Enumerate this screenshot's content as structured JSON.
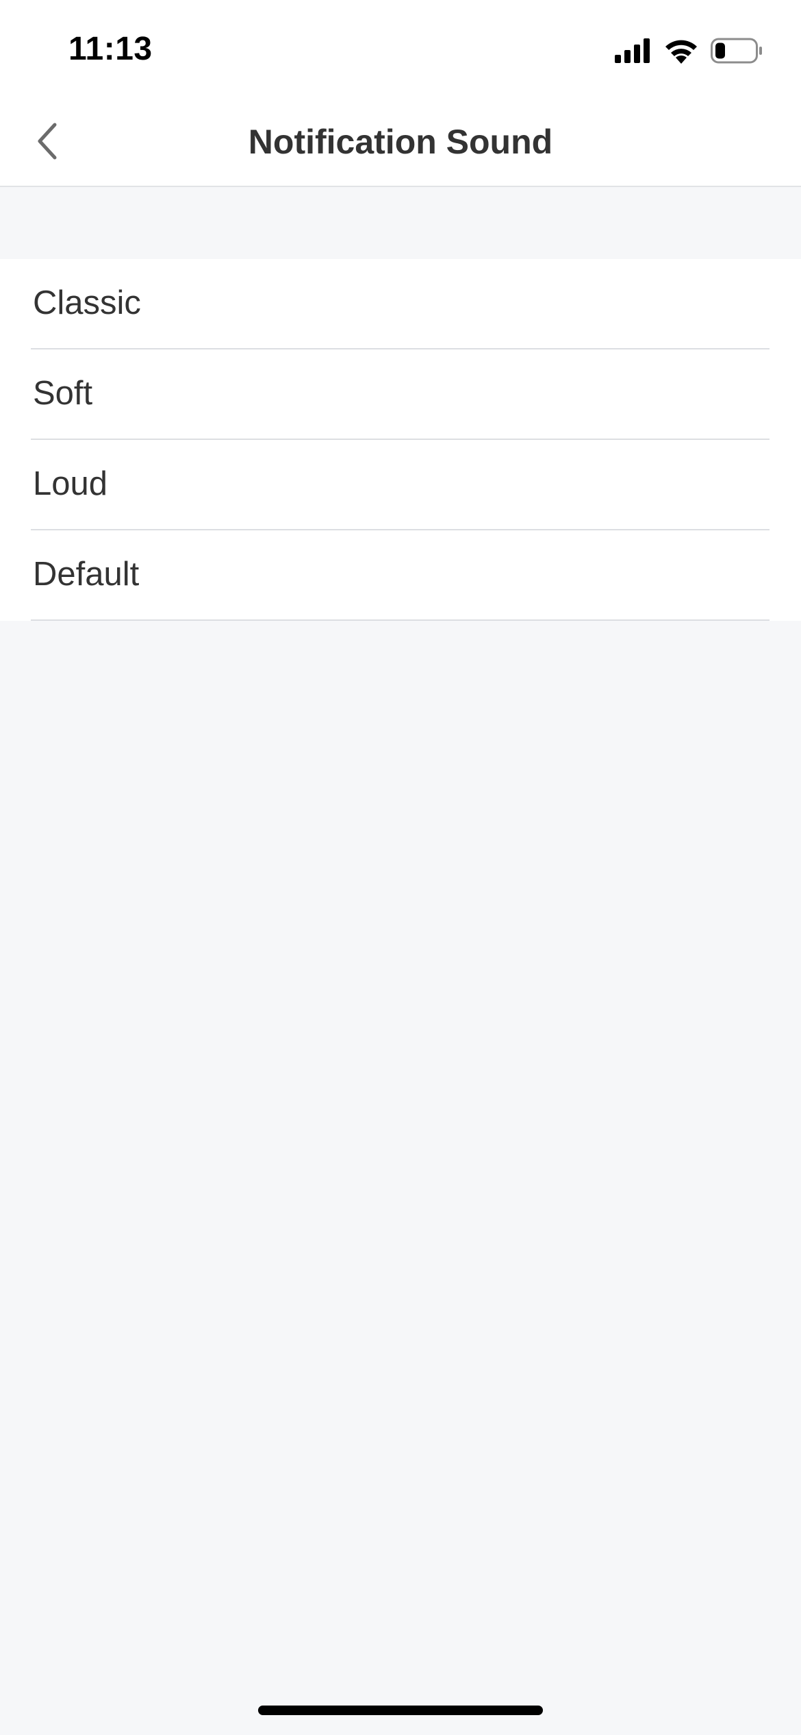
{
  "status_bar": {
    "time": "11:13",
    "icons": [
      "cellular-signal-icon",
      "wifi-icon",
      "battery-icon"
    ],
    "battery_level": 0.25
  },
  "nav_bar": {
    "back_icon": "chevron-left-icon",
    "title": "Notification Sound"
  },
  "options": [
    {
      "label": "Classic"
    },
    {
      "label": "Soft"
    },
    {
      "label": "Loud"
    },
    {
      "label": "Default"
    }
  ],
  "colors": {
    "background": "#f6f7f9",
    "surface": "#ffffff",
    "text": "#333333",
    "divider": "#dcdee2",
    "icon": "#000000"
  }
}
